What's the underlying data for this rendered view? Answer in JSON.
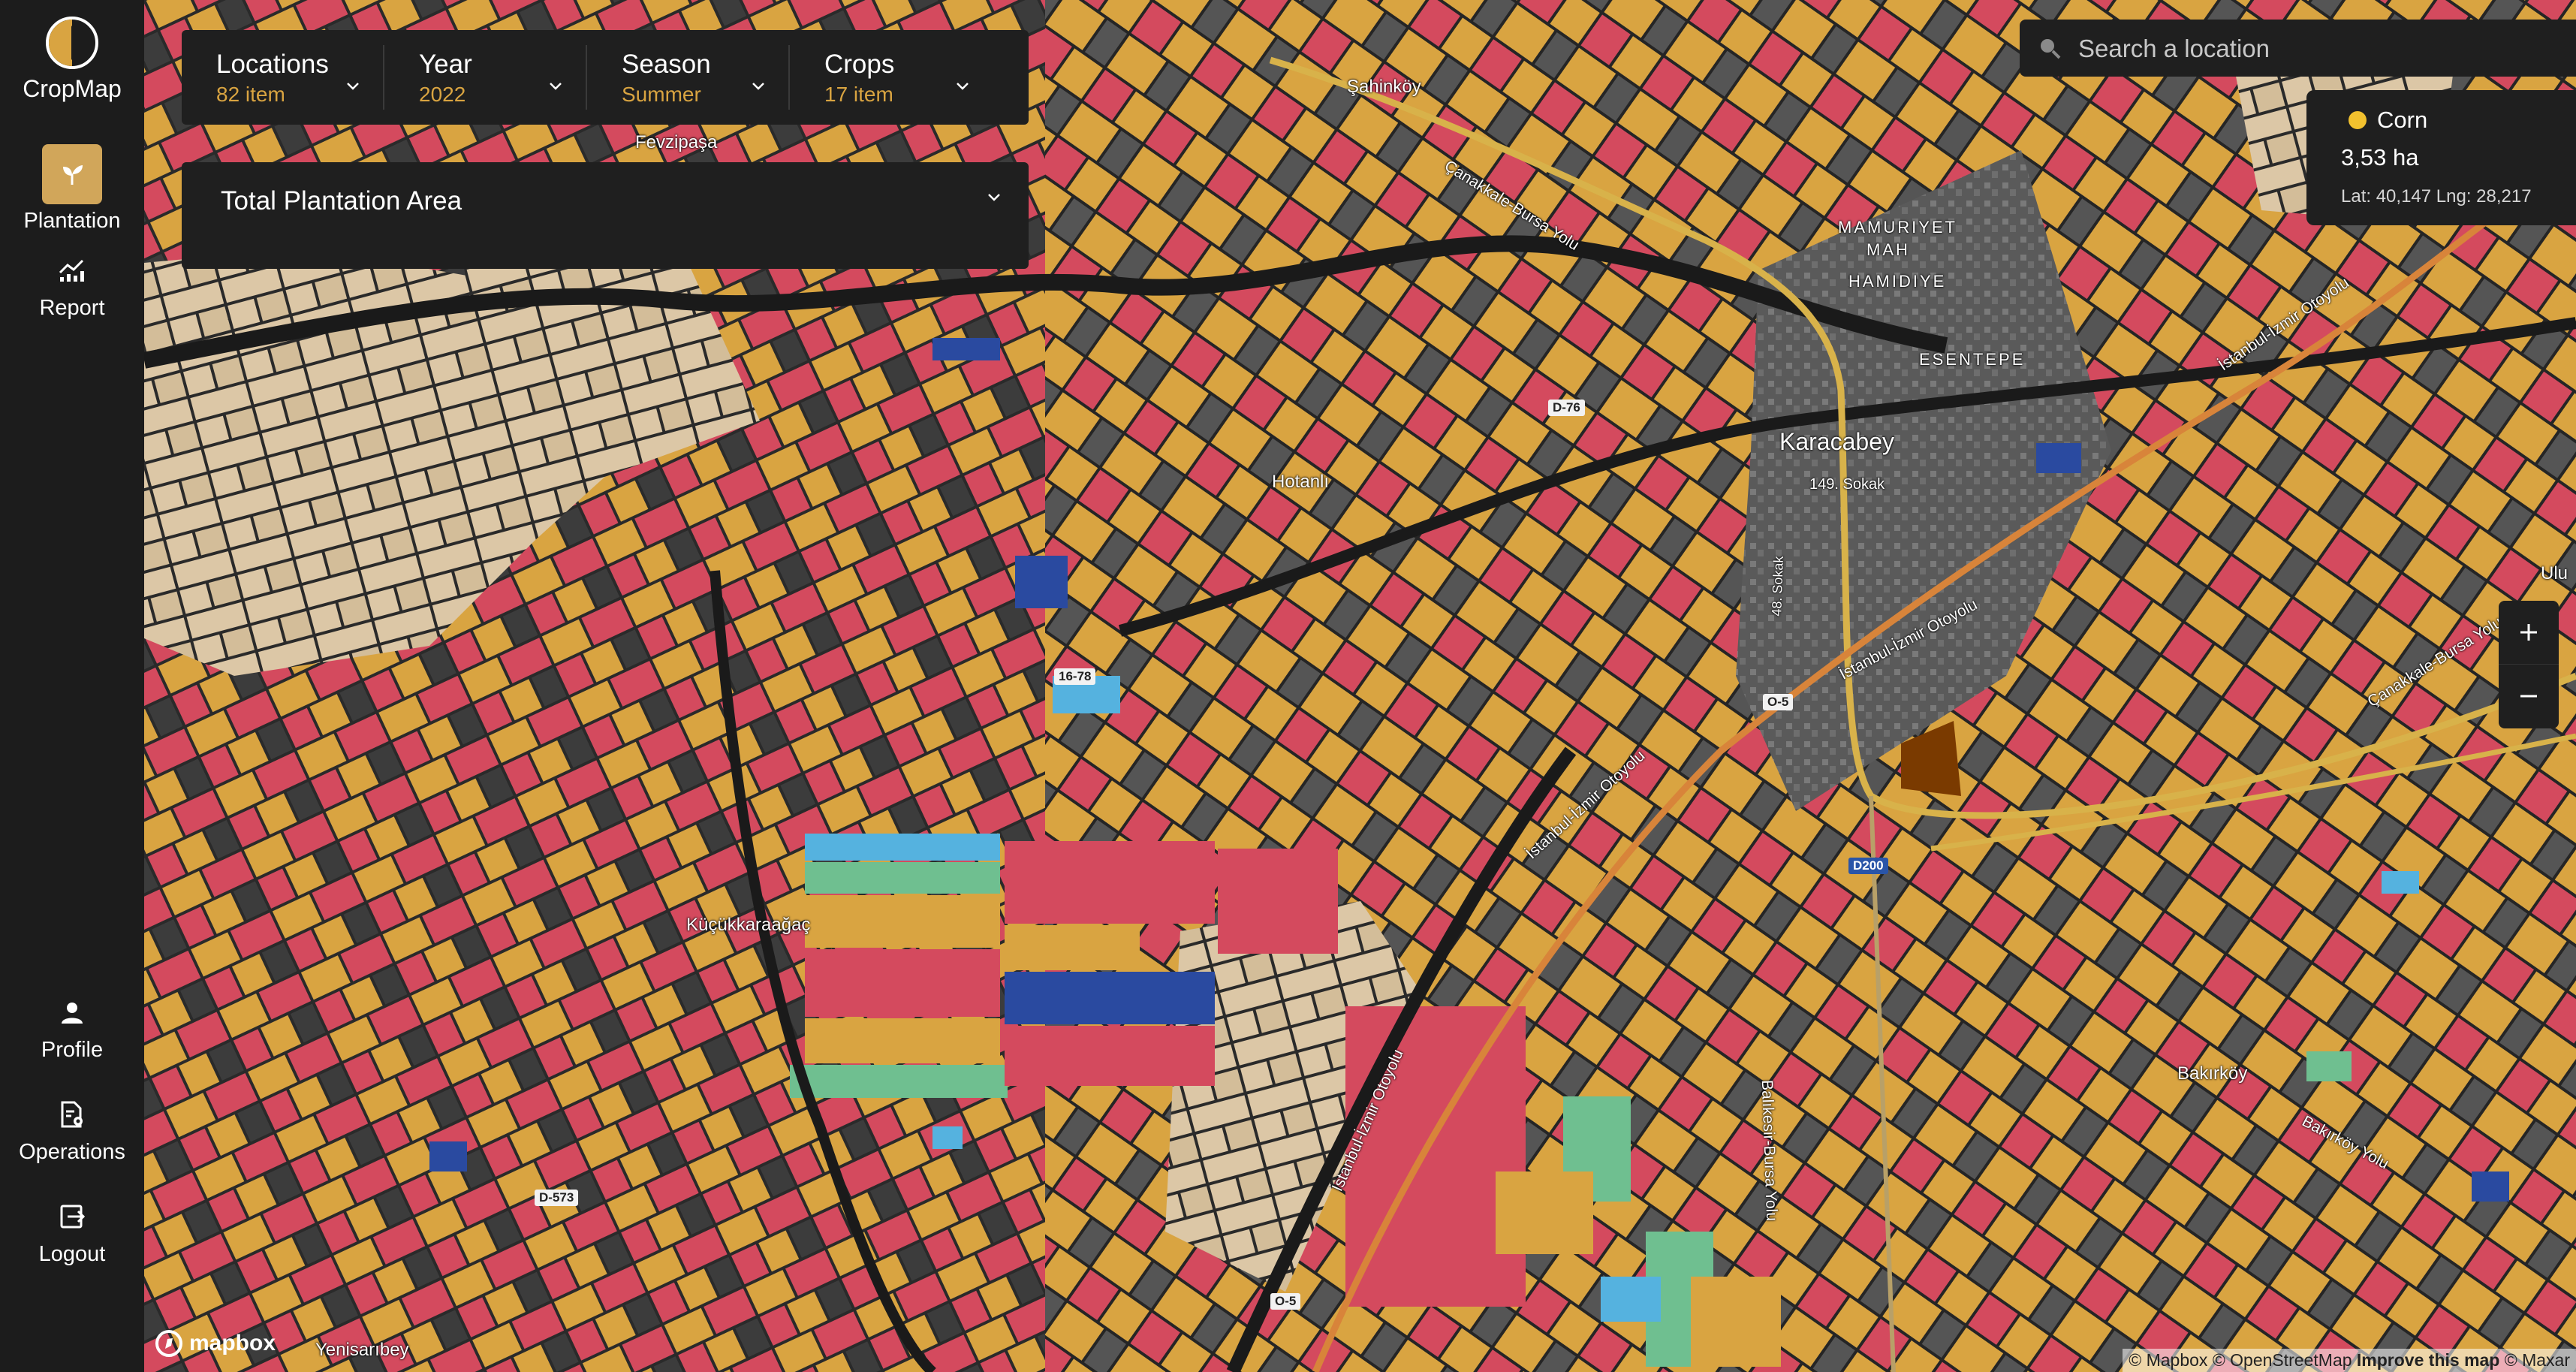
{
  "app": {
    "name": "CropMap"
  },
  "sidebar": {
    "top_items": [
      {
        "label": "Plantation",
        "icon": "plant-icon",
        "active": true
      },
      {
        "label": "Report",
        "icon": "chart-icon",
        "active": false
      }
    ],
    "bottom_items": [
      {
        "label": "Profile",
        "icon": "user-icon"
      },
      {
        "label": "Operations",
        "icon": "operations-icon"
      },
      {
        "label": "Logout",
        "icon": "logout-icon"
      }
    ]
  },
  "filters": [
    {
      "label": "Locations",
      "value": "82 item"
    },
    {
      "label": "Year",
      "value": "2022"
    },
    {
      "label": "Season",
      "value": "Summer"
    },
    {
      "label": "Crops",
      "value": "17 item"
    }
  ],
  "area_panel": {
    "title": "Total Plantation Area"
  },
  "search": {
    "placeholder": "Search a location"
  },
  "info": {
    "crop": "Corn",
    "crop_color": "#f2c12e",
    "area": "3,53 ha",
    "coords": "Lat: 40,147  Lng: 28,217"
  },
  "zoom": {
    "in": "+",
    "out": "−"
  },
  "map_labels": {
    "places": [
      "Şahinköy",
      "Fevzipaşa",
      "MAMURIYET",
      "MAH",
      "HAMIDIYE",
      "ESENTEPE",
      "Karacabey",
      "149. Sokak",
      "Hotanlı",
      "Küçükkaraağaç",
      "Bakırköy",
      "Yenisarıbey",
      "Ulu"
    ],
    "roads": [
      "Çanakkale-Bursa Yolu",
      "İstanbul-İzmir Otoyolu",
      "İstanbul-İzmir Otoyolu",
      "İstanbul-İzmir Otoyolu",
      "İstanbul-İzmir Otoyolu",
      "Balıkesir-Bursa Yolu",
      "Bakırköy Yolu",
      "Çanakkale-Bursa Yolu",
      "48. Sokak"
    ],
    "badges": [
      "D-76",
      "16-78",
      "O-5",
      "D200",
      "O-5",
      "D-573"
    ]
  },
  "attribution": {
    "mapbox_logo": "mapbox",
    "credits": "© Mapbox © OpenStreetMap",
    "improve": "Improve this map",
    "maxar": "© Maxar"
  },
  "legend_colors": {
    "corn": "#d9a441",
    "red_crop": "#d44a5e",
    "light_blue_crop": "#55b2df",
    "blue_crop": "#2a4aa0",
    "green_crop": "#6fbf90",
    "beige_crop": "#dcc7a6",
    "sidebar_bg": "#1c1c1c",
    "accent": "#d1a65a"
  }
}
